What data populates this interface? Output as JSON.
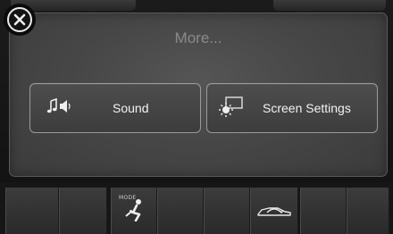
{
  "panel": {
    "title": "More..."
  },
  "buttons": {
    "sound": {
      "label": "Sound",
      "icon": "music-speaker-icon"
    },
    "screen_settings": {
      "label": "Screen Settings",
      "icon": "screen-brightness-icon"
    }
  },
  "close": {
    "icon": "close-icon"
  },
  "dock": {
    "mode_label": "MODE",
    "items": [
      "blank",
      "blank",
      "fan-mode-icon",
      "blank",
      "blank",
      "car-recirculation-icon",
      "blank",
      "blank"
    ]
  }
}
